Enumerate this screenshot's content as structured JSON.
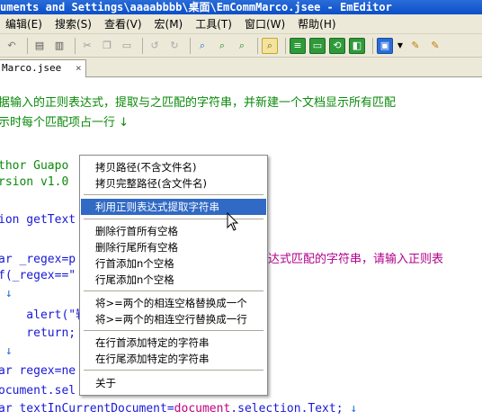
{
  "window": {
    "title": "uments and Settings\\aaaabbbb\\桌面\\EmCommMarco.jsee - EmEditor"
  },
  "menubar": {
    "items": [
      "编辑(E)",
      "搜索(S)",
      "查看(V)",
      "宏(M)",
      "工具(T)",
      "窗口(W)",
      "帮助(H)"
    ]
  },
  "toolbar": {
    "icons": [
      "undo-icon",
      "print-icon",
      "print-preview-icon",
      "cut-icon",
      "copy-icon",
      "paste-icon",
      "undo-arrow-icon",
      "redo-arrow-icon",
      "find-icon",
      "find-next-icon",
      "find-prev-icon",
      "search-files-icon",
      "outline-icon",
      "window-icon",
      "refresh-icon",
      "split-icon",
      "macro-icon",
      "dropdown-icon",
      "settings-icon",
      "help-icon"
    ]
  },
  "tab": {
    "label": "Marco.jsee",
    "close": "×"
  },
  "editor": {
    "lines": {
      "l1": "据输入的正则表达式，提取与之匹配的字符串，并新建一个文档显示所有匹配",
      "l2": "示时每个匹配项占一行 ↓",
      "l3a": "thor Guapo",
      "l4a": "rsion v1.0",
      "l5a": "ion getText",
      "l6a": "ar _regex=p",
      "l6b": "达式匹配的字符串，请输入正则表",
      "l7a": "f(_regex==\"",
      "l8a": " ↓",
      "l9a": "    alert(\"输",
      "l10a": "    return;",
      "l11a": " ↓",
      "l12a": "ar regex=ne",
      "l13a": "ocument.sel",
      "l14a": "ar textInCurrentDocument=",
      "l14b": "document",
      "l14c": ".selection.Text; ",
      "l14d": "↓"
    }
  },
  "context_menu": {
    "items": {
      "copy_path_no_name": "拷贝路径(不含文件名)",
      "copy_full_path": "拷贝完整路径(含文件名)",
      "extract_regex": "利用正则表达式提取字符串",
      "delete_leading_spaces": "删除行首所有空格",
      "delete_trailing_spaces": "删除行尾所有空格",
      "add_leading_spaces": "行首添加n个空格",
      "add_trailing_spaces": "行尾添加n个空格",
      "replace_spaces": "将>=两个的相连空格替换成一个",
      "replace_blank_lines": "将>=两个的相连空行替换成一行",
      "add_line_start_text": "在行首添加特定的字符串",
      "add_line_end_text": "在行尾添加特定的字符串",
      "about": "关于"
    },
    "highlight_color": "#316ac5"
  }
}
